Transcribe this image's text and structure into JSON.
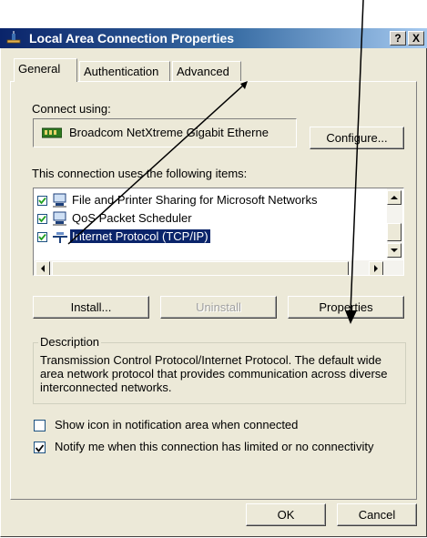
{
  "window": {
    "title": "Local Area Connection Properties",
    "help_glyph": "?",
    "close_glyph": "X"
  },
  "tabs": [
    {
      "label": "General",
      "active": true
    },
    {
      "label": "Authentication",
      "active": false
    },
    {
      "label": "Advanced",
      "active": false
    }
  ],
  "connect_using": {
    "label": "Connect using:",
    "adapter_name": "Broadcom NetXtreme Gigabit Etherne",
    "configure_label": "Configure..."
  },
  "items_section": {
    "label": "This connection uses the following items:",
    "items": [
      {
        "label": "File and Printer Sharing for Microsoft Networks",
        "checked": true,
        "selected": false,
        "icon": "network-service-icon"
      },
      {
        "label": "QoS Packet Scheduler",
        "checked": true,
        "selected": false,
        "icon": "network-service-icon"
      },
      {
        "label": "Internet Protocol (TCP/IP)",
        "checked": true,
        "selected": true,
        "icon": "protocol-icon"
      }
    ]
  },
  "buttons": {
    "install": "Install...",
    "uninstall": "Uninstall",
    "properties": "Properties",
    "ok": "OK",
    "cancel": "Cancel"
  },
  "description": {
    "legend": "Description",
    "text": "Transmission Control Protocol/Internet Protocol. The default wide area network protocol that provides communication across diverse interconnected networks."
  },
  "options": {
    "show_icon": {
      "label": "Show icon in notification area when connected",
      "checked": false
    },
    "notify": {
      "label": "Notify me when this connection has limited or no connectivity",
      "checked": true
    }
  },
  "colors": {
    "dialog_bg": "#ece9d8",
    "title_start": "#0a246a",
    "selection": "#0a246a",
    "annotation": "#000000"
  }
}
